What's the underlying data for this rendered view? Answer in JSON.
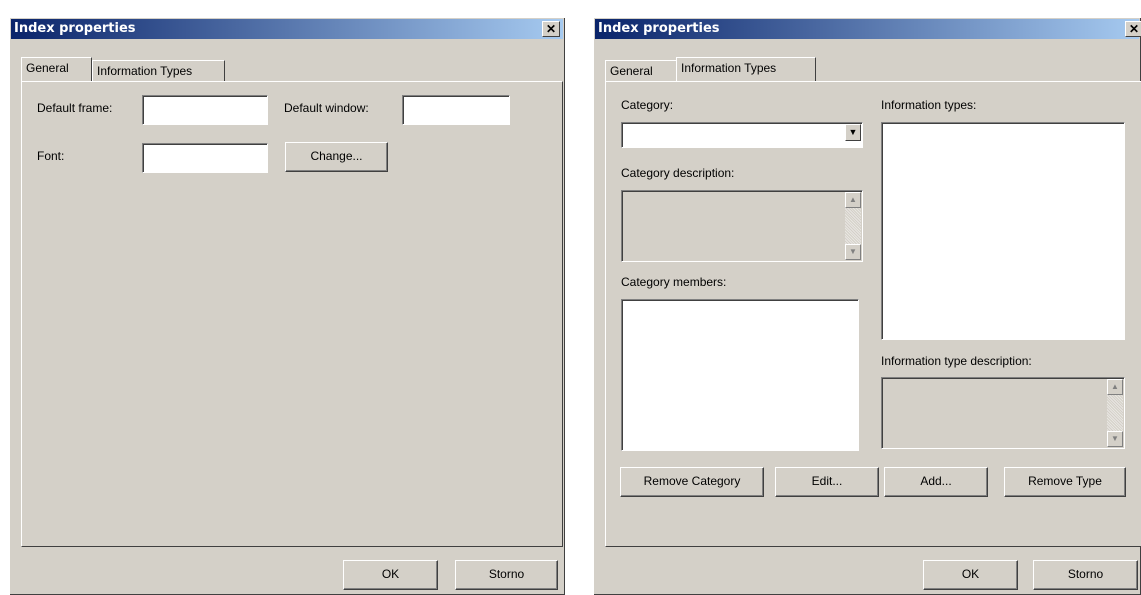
{
  "dialog1": {
    "title": "Index properties",
    "close_glyph": "✕",
    "tabs": [
      "General",
      "Information Types"
    ],
    "active_tab": "General",
    "labels": {
      "default_frame": "Default frame:",
      "default_window": "Default window:",
      "font": "Font:"
    },
    "fields": {
      "default_frame": "",
      "default_window": "",
      "font": ""
    },
    "buttons": {
      "change": "Change...",
      "ok": "OK",
      "cancel": "Storno"
    }
  },
  "dialog2": {
    "title": "Index properties",
    "close_glyph": "✕",
    "tabs": [
      "General",
      "Information Types"
    ],
    "active_tab": "Information Types",
    "labels": {
      "category": "Category:",
      "category_description": "Category description:",
      "category_members": "Category members:",
      "information_types": "Information types:",
      "information_type_description": "Information type description:"
    },
    "category_value": "",
    "buttons": {
      "remove_category": "Remove Category",
      "edit": "Edit...",
      "add": "Add...",
      "remove_type": "Remove Type",
      "ok": "OK",
      "cancel": "Storno"
    }
  },
  "icons": {
    "dropdown_arrow": "▼",
    "scroll_up": "▲",
    "scroll_down": "▼"
  }
}
